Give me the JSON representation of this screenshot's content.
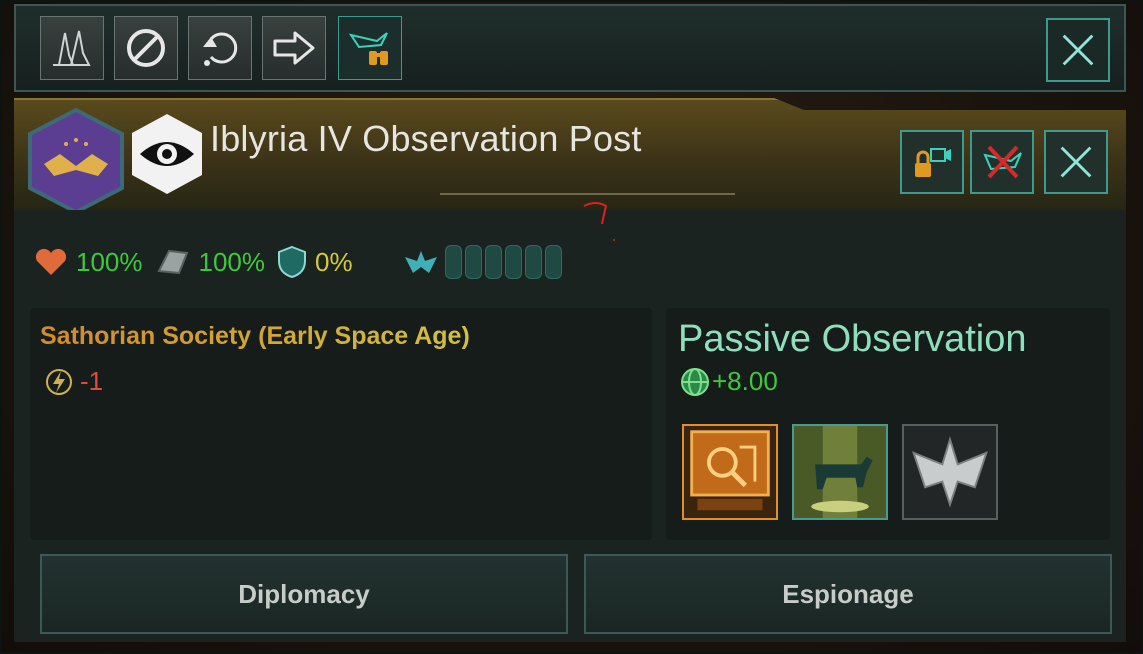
{
  "toolbar": {
    "buttons": [
      {
        "icon": "fleet-ships-icon"
      },
      {
        "icon": "prohibit-icon"
      },
      {
        "icon": "return-rotate-icon"
      },
      {
        "icon": "arrow-right-icon"
      },
      {
        "icon": "science-ship-binoculars-icon"
      }
    ],
    "close_icon": "close-icon"
  },
  "header": {
    "title": "Iblyria IV Observation Post",
    "emblem_icon": "empire-emblem-icon",
    "eye_icon": "eye-icon",
    "buttons": [
      {
        "icon": "camera-lock-icon"
      },
      {
        "icon": "disband-ship-icon"
      },
      {
        "icon": "close-icon"
      }
    ]
  },
  "stats": {
    "hull": "100%",
    "armor": "100%",
    "shield": "0%",
    "outpost_pips": 6
  },
  "society": {
    "name": "Sathorian Society (Early Space Age)",
    "modifier": "-1"
  },
  "observation": {
    "title": "Passive Observation",
    "value": "+8.00",
    "options": [
      "research-terminal-icon",
      "cattle-abduction-icon",
      "warship-icon"
    ]
  },
  "actions": {
    "diplomacy": "Diplomacy",
    "espionage": "Espionage"
  },
  "colors": {
    "accent_teal": "#3e9a8f",
    "positive": "#3ec83c",
    "negative": "#e04a3a",
    "warning": "#d4c93c",
    "header_gold": "#5a4a1c"
  }
}
